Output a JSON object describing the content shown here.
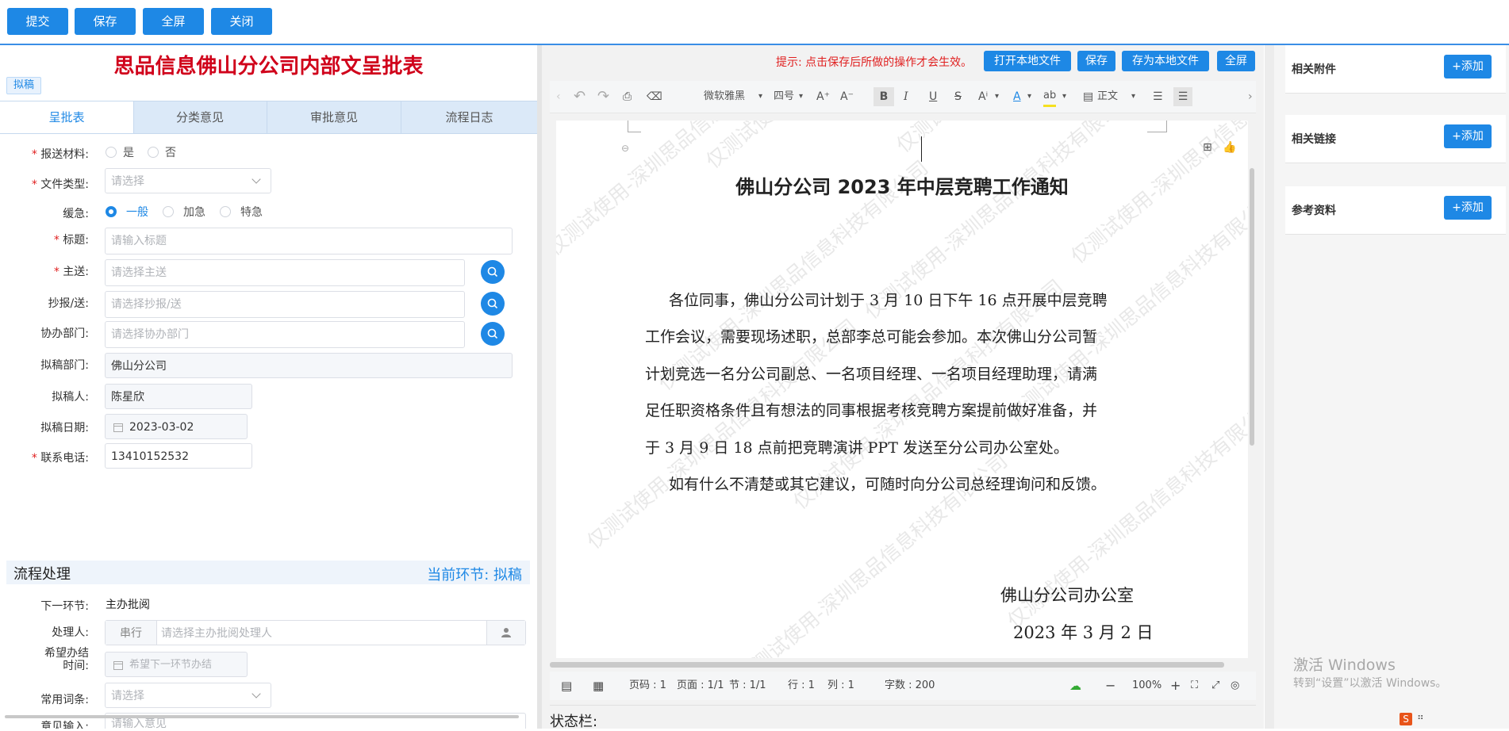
{
  "top_buttons": {
    "submit": "提交",
    "save": "保存",
    "fullscreen": "全屏",
    "close": "关闭"
  },
  "form": {
    "title": "思品信息佛山分公司内部文呈批表",
    "status_tag": "拟稿",
    "tabs": [
      "呈批表",
      "分类意见",
      "审批意见",
      "流程日志"
    ],
    "fields": {
      "report_material": {
        "label": "报送材料:",
        "options": [
          "是",
          "否"
        ]
      },
      "doc_type": {
        "label": "文件类型:",
        "placeholder": "请选择"
      },
      "urgency": {
        "label": "缓急:",
        "options": [
          "一般",
          "加急",
          "特急"
        ],
        "selected": "一般"
      },
      "title": {
        "label": "标题:",
        "placeholder": "请输入标题"
      },
      "main_to": {
        "label": "主送:",
        "placeholder": "请选择主送"
      },
      "cc": {
        "label": "抄报/送:",
        "placeholder": "请选择抄报/送"
      },
      "assist_dept": {
        "label": "协办部门:",
        "placeholder": "请选择协办部门"
      },
      "draft_dept": {
        "label": "拟稿部门:",
        "value": "佛山分公司"
      },
      "drafter": {
        "label": "拟稿人:",
        "value": "陈星欣"
      },
      "draft_date": {
        "label": "拟稿日期:",
        "value": "2023-03-02"
      },
      "phone": {
        "label": "联系电话:",
        "value": "13410152532"
      }
    }
  },
  "flow": {
    "section_title": "流程处理",
    "current_step": "当前环节: 拟稿",
    "next_step": {
      "label": "下一环节:",
      "value": "主办批阅"
    },
    "handler": {
      "label": "处理人:",
      "mode": "串行",
      "placeholder": "请选择主办批阅处理人"
    },
    "expect_time": {
      "label1": "希望办结",
      "label2": "时间:",
      "placeholder": "希望下一环节办结"
    },
    "common_phrases": {
      "label": "常用词条:",
      "placeholder": "请选择"
    },
    "opinion": {
      "label": "意见输入:",
      "placeholder": "请输入意见"
    }
  },
  "editor": {
    "hint": "提示: 点击保存后所做的操作才会生效。",
    "buttons": {
      "open_local": "打开本地文件",
      "save": "保存",
      "save_local": "存为本地文件",
      "fullscreen": "全屏"
    },
    "font_name": "微软雅黑",
    "font_size": "四号",
    "style": "正文",
    "doc_title": "佛山分公司 2023 年中层竞聘工作通知",
    "body_lines": [
      "各位同事，佛山分公司计划于 3 月 10 日下午 16 点开展中层竞聘",
      "工作会议，需要现场述职，总部李总可能会参加。本次佛山分公司暂",
      "计划竞选一名分公司副总、一名项目经理、一名项目经理助理，请满",
      "足任职资格条件且有想法的同事根据考核竞聘方案提前做好准备，并",
      "于 3 月 9 日 18 点前把竞聘演讲 PPT 发送至分公司办公室处。",
      "如有什么不清楚或其它建议，可随时向分公司总经理询问和反馈。"
    ],
    "signature": "佛山分公司办公室",
    "date": "2023 年 3 月 2 日",
    "watermark": "仅测试使用-深圳思品信息科技有限公司",
    "status": {
      "page_no": "页码 : 1",
      "pages": "页面 : 1/1",
      "section": "节 : 1/1",
      "row": "行 : 1",
      "col": "列 : 1",
      "chars": "字数 : 200",
      "zoom": "100%"
    }
  },
  "status_bar_label": "状态栏:",
  "right_panel": {
    "sections": [
      {
        "title": "相关附件",
        "button": "+添加"
      },
      {
        "title": "相关链接",
        "button": "+添加"
      },
      {
        "title": "参考资料",
        "button": "+添加"
      }
    ],
    "activate_title": "激活 Windows",
    "activate_sub": "转到“设置”以激活 Windows。"
  }
}
